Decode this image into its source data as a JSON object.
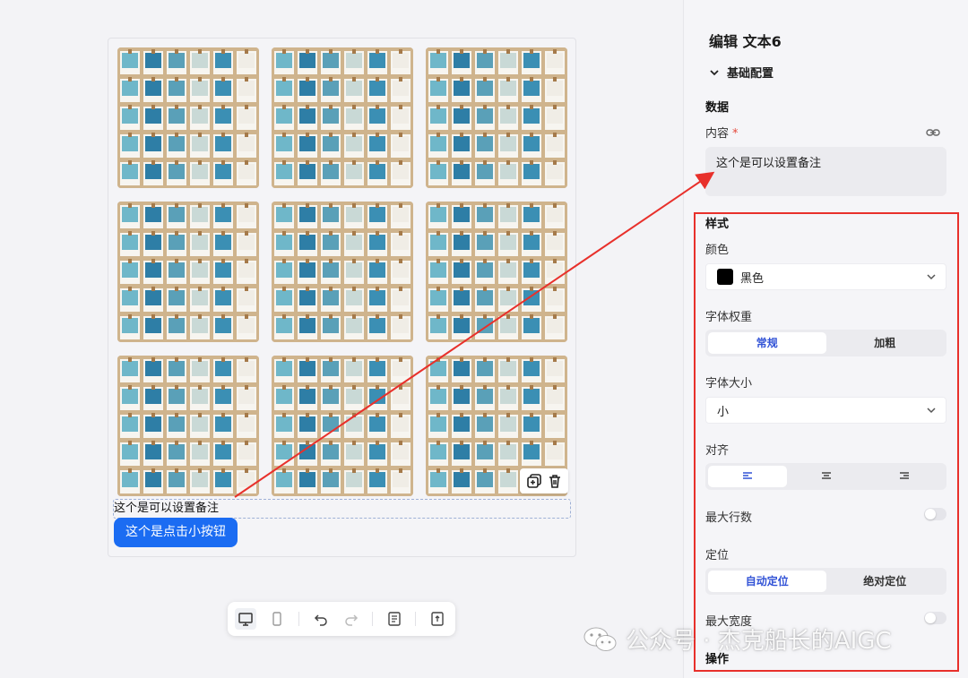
{
  "canvas": {
    "note_text": "这个是可以设置备注",
    "button_label": "这个是点击小按钮"
  },
  "panel": {
    "title": "编辑 文本6",
    "section": "基础配置",
    "data_heading": "数据",
    "content_label": "内容",
    "required_mark": "*",
    "content_value": "这个是可以设置备注",
    "style_heading": "样式",
    "color_label": "颜色",
    "color_value": "黑色",
    "color_hex": "#000000",
    "weight_label": "字体权重",
    "weight_options": [
      "常规",
      "加粗"
    ],
    "size_label": "字体大小",
    "size_value": "小",
    "align_label": "对齐",
    "max_lines_label": "最大行数",
    "position_label": "定位",
    "position_options": [
      "自动定位",
      "绝对定位"
    ],
    "max_width_label": "最大宽度",
    "ops_heading": "操作"
  },
  "watermark": {
    "text": "公众号 · 杰克船长的AIGC"
  },
  "colors": {
    "accent": "#1b6cf2",
    "annotation": "#e8302b",
    "segment_active_text": "#3152d6"
  }
}
